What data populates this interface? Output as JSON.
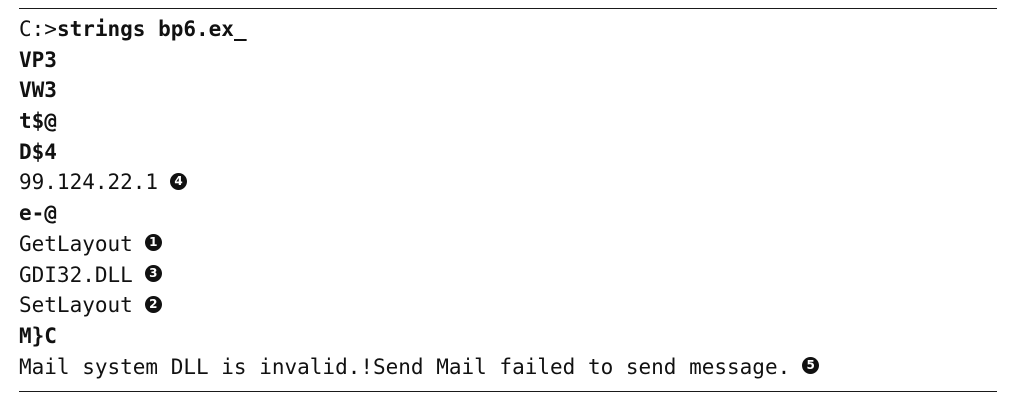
{
  "lines": [
    {
      "prompt": "C:>",
      "command": "strings bp6.ex_"
    },
    {
      "text": "VP3",
      "bold": true
    },
    {
      "text": "VW3",
      "bold": true
    },
    {
      "text": "t$@",
      "bold": true
    },
    {
      "text": "D$4",
      "bold": true
    },
    {
      "text": "99.124.22.1",
      "bold": false,
      "marker": "4"
    },
    {
      "text": "e-@",
      "bold": true
    },
    {
      "text": "GetLayout",
      "bold": false,
      "marker": "1"
    },
    {
      "text": "GDI32.DLL",
      "bold": false,
      "marker": "3"
    },
    {
      "text": "SetLayout",
      "bold": false,
      "marker": "2"
    },
    {
      "text": "M}C",
      "bold": true
    },
    {
      "text": "Mail system DLL is invalid.!Send Mail failed to send message.",
      "bold": false,
      "marker": "5"
    }
  ]
}
